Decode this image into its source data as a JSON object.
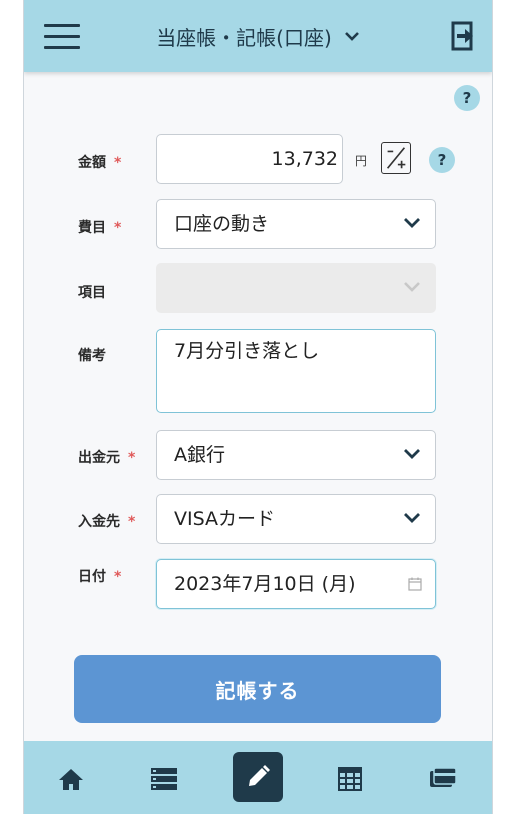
{
  "header": {
    "title": "当座帳・記帳(口座)"
  },
  "form": {
    "amount": {
      "label": "金額",
      "required_mark": "*",
      "value": "13,732",
      "unit": "円"
    },
    "category": {
      "label": "費目",
      "required_mark": "*",
      "value": "口座の動き"
    },
    "item": {
      "label": "項目",
      "value": ""
    },
    "memo": {
      "label": "備考",
      "value": "7月分引き落とし"
    },
    "from_account": {
      "label": "出金元",
      "required_mark": "*",
      "value": "A銀行"
    },
    "to_account": {
      "label": "入金先",
      "required_mark": "*",
      "value": "VISAカード"
    },
    "date": {
      "label": "日付",
      "required_mark": "*",
      "value": "2023年7月10日 (月)"
    }
  },
  "help_label": "?",
  "submit_label": "記帳する",
  "footer_nav": [
    "home-icon",
    "list-icon",
    "pencil-icon",
    "calendar-grid-icon",
    "wallet-icon"
  ],
  "colors": {
    "header_bg": "#a6d8e6",
    "accent": "#5c95d3",
    "required": "#e05a5a",
    "active_nav": "#1f3a4a"
  }
}
